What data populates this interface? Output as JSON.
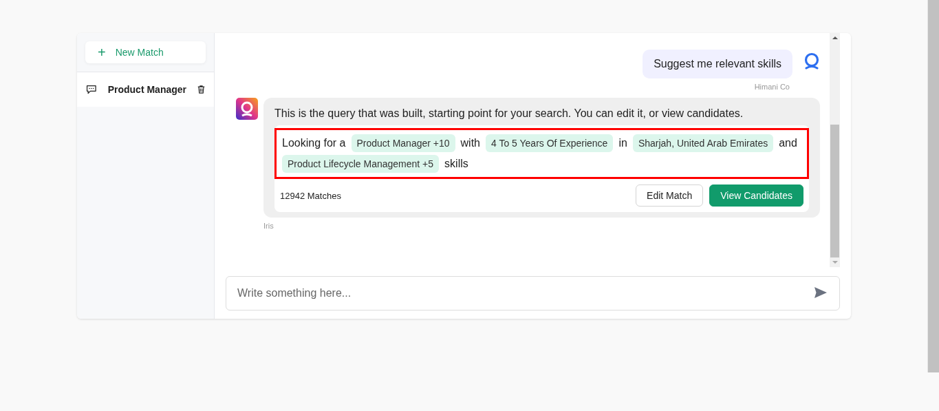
{
  "sidebar": {
    "new_button": {
      "icon": "+",
      "label": "New Match"
    },
    "items": [
      {
        "label": "Product Manager",
        "selected": true
      }
    ]
  },
  "messages": [
    {
      "kind": "user",
      "text": "Suggest me relevant skills",
      "author": "Himani Co"
    },
    {
      "kind": "bot",
      "text": "This is the query that was built, starting point for your search. You can edit it, or view candidates.",
      "author": "Iris",
      "query": {
        "highlighted": true,
        "segments": [
          {
            "kind": "text",
            "text": "Looking for a"
          },
          {
            "kind": "tag",
            "text": "Product Manager +10"
          },
          {
            "kind": "text",
            "text": "with"
          },
          {
            "kind": "tag",
            "text": "4 To 5 Years Of Experience"
          },
          {
            "kind": "text",
            "text": "in"
          },
          {
            "kind": "tag",
            "text": "Sharjah, United Arab Emirates"
          },
          {
            "kind": "text",
            "text": "and"
          },
          {
            "kind": "tag",
            "text": "Product Lifecycle Management +5"
          },
          {
            "kind": "text",
            "text": "skills"
          }
        ],
        "matches": "12942 Matches",
        "buttons": [
          {
            "kind": "secondary",
            "label": "Edit Match"
          },
          {
            "kind": "primary",
            "label": "View Candidates"
          }
        ]
      }
    }
  ],
  "composer": {
    "placeholder": "Write something here..."
  }
}
